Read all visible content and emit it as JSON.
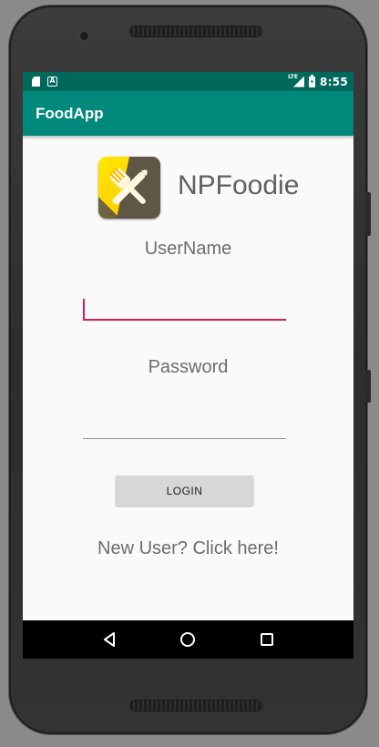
{
  "status_bar": {
    "time": "8:55",
    "network_label": "LTE",
    "notification_icons": [
      "sd-card-icon",
      "a-notification-icon"
    ]
  },
  "app_bar": {
    "title": "FoodApp"
  },
  "brand": {
    "name": "NPFoodie",
    "logo_icon": "fork-knife-icon"
  },
  "form": {
    "username_label": "UserName",
    "username_value": "",
    "password_label": "Password",
    "password_value": "",
    "login_label": "LOGIN",
    "signup_link": "New User? Click here!"
  },
  "nav_bar": {
    "buttons": [
      "back-icon",
      "home-icon",
      "recents-icon"
    ]
  },
  "colors": {
    "status_bar": "#00695c",
    "app_bar": "#00897b",
    "accent": "#d81b60",
    "logo_yellow": "#ffd400"
  }
}
